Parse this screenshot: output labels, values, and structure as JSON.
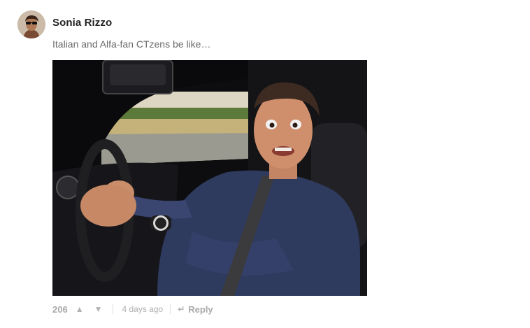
{
  "comment": {
    "author": "Sonia Rizzo",
    "text": "Italian and Alfa-fan CTzens be like…",
    "votes": "206",
    "upvote_icon": "▲",
    "downvote_icon": "▼",
    "timestamp": "4 days ago",
    "reply_icon": "↵",
    "reply_label": "Reply"
  }
}
